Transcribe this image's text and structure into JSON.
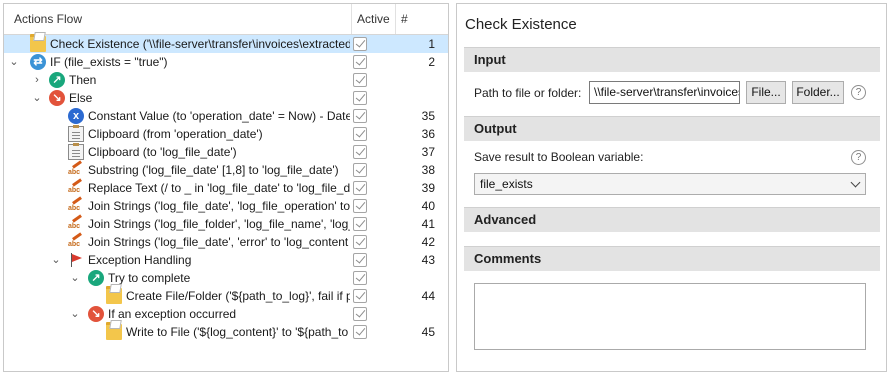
{
  "flow": {
    "headers": {
      "name": "Actions Flow",
      "active": "Active",
      "number": "#"
    },
    "rows": [
      {
        "label": "Check Existence ('\\\\file-server\\transfer\\invoices\\extracted",
        "num": "1",
        "icon": "folder-icon"
      },
      {
        "label": "IF (file_exists = \"true\")",
        "num": "2",
        "icon": "if-branch-icon"
      },
      {
        "label": "Then",
        "num": "",
        "icon": "then-arrow-icon"
      },
      {
        "label": "Else",
        "num": "",
        "icon": "else-arrow-icon"
      },
      {
        "label": "Constant Value (to 'operation_date' = Now) - Date",
        "num": "35",
        "icon": "variable-x-icon"
      },
      {
        "label": "Clipboard (from 'operation_date')",
        "num": "36",
        "icon": "clipboard-icon"
      },
      {
        "label": "Clipboard (to 'log_file_date')",
        "num": "37",
        "icon": "clipboard-icon"
      },
      {
        "label": "Substring ('log_file_date' [1,8] to 'log_file_date')",
        "num": "38",
        "icon": "text-abc-icon"
      },
      {
        "label": "Replace Text (/ to _ in 'log_file_date' to 'log_file_da",
        "num": "39",
        "icon": "text-abc-icon"
      },
      {
        "label": "Join Strings ('log_file_date', 'log_file_operation' to",
        "num": "40",
        "icon": "text-abc-icon"
      },
      {
        "label": "Join Strings ('log_file_folder', 'log_file_name', 'log_",
        "num": "41",
        "icon": "text-abc-icon"
      },
      {
        "label": "Join Strings ('log_file_date', 'error' to 'log_content",
        "num": "42",
        "icon": "text-abc-icon"
      },
      {
        "label": "Exception Handling",
        "num": "43",
        "icon": "flag-icon"
      },
      {
        "label": "Try to complete",
        "num": "",
        "icon": "then-arrow-icon"
      },
      {
        "label": "Create File/Folder ('${path_to_log}', fail if p",
        "num": "44",
        "icon": "folder-icon"
      },
      {
        "label": "If an exception occurred",
        "num": "",
        "icon": "else-arrow-icon"
      },
      {
        "label": "Write to File ('${log_content}' to '${path_to",
        "num": "45",
        "icon": "folder-icon"
      }
    ]
  },
  "props": {
    "title": "Check Existence",
    "input_section": "Input",
    "path_label": "Path to file or folder:",
    "path_value": "\\\\file-server\\transfer\\invoices\\extracted",
    "file_button": "File...",
    "folder_button": "Folder...",
    "help_glyph": "?",
    "output_section": "Output",
    "save_label": "Save result to Boolean variable:",
    "save_value": "file_exists",
    "advanced_section": "Advanced",
    "comments_section": "Comments",
    "comments_value": ""
  }
}
